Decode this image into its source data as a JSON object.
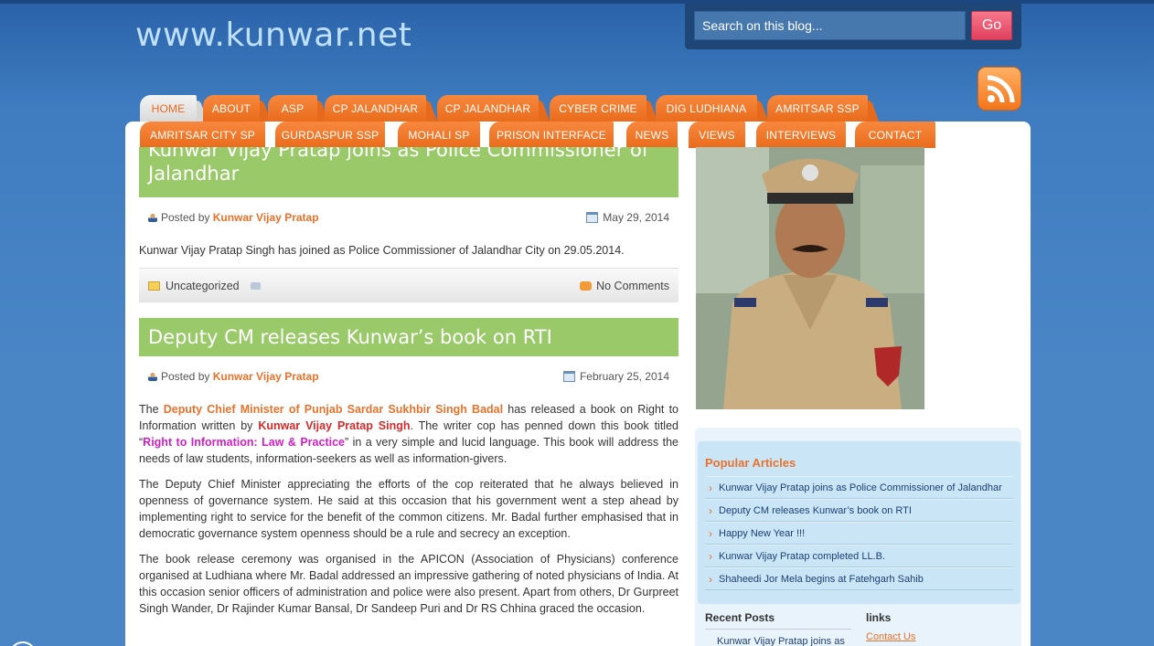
{
  "site": {
    "title": "www.kunwar.net"
  },
  "search": {
    "placeholder": "Search on this blog...",
    "button": "Go"
  },
  "nav": {
    "row1": [
      "HOME",
      "ABOUT",
      "ASP",
      "CP JALANDHAR",
      "CP JALANDHAR",
      "CYBER CRIME",
      "DIG LUDHIANA",
      "AMRITSAR SSP"
    ],
    "row2": [
      "AMRITSAR CITY SP",
      "GURDASPUR SSP",
      "MOHALI SP",
      "PRISON INTERFACE",
      "NEWS",
      "VIEWS",
      "INTERVIEWS",
      "CONTACT"
    ],
    "active": "HOME"
  },
  "post1": {
    "title": "Kunwar Vijay Pratap joins as Police Commissioner of Jalandhar",
    "posted_by_label": "Posted by",
    "author": "Kunwar Vijay Pratap",
    "date": "May 29, 2014",
    "body": "Kunwar Vijay Pratap Singh has joined as Police Commissioner of Jalandhar City on 29.05.2014.",
    "category": "Uncategorized",
    "comments": "No Comments"
  },
  "post2": {
    "title": "Deputy CM releases Kunwar’s book on RTI",
    "posted_by_label": "Posted by",
    "author": "Kunwar Vijay Pratap",
    "date": "February 25, 2014",
    "p1": {
      "t1": "The ",
      "h1": "Deputy Chief Minister of Punjab Sardar Sukhbir Singh Badal",
      "t2": " has released a book on Right to Information written by ",
      "h2": "Kunwar Vijay Pratap Singh",
      "t3": ". The writer cop has penned down this book titled “",
      "h3": "Right to Information: Law & Practice",
      "t4": "” in a very simple and lucid language. This book will address the needs of law students, information-seekers as well as information-givers."
    },
    "p2": "The Deputy Chief Minister appreciating the efforts of the cop reiterated that he always believed in openness of governance system. He said at this occasion that his government went a step ahead by implementing right to service for the benefit of the common citizens. Mr. Badal further emphasised that in democratic governance system openness should be a rule and secrecy an exception.",
    "p3": "The book release ceremony was organised in the APICON (Association of Physicians) conference organised at Ludhiana where Mr. Badal addressed an impressive gathering of noted physicians of India. At this occasion senior officers of administration and police were also present. Apart from others, Dr Gurpreet Singh Wander, Dr Rajinder Kumar Bansal, Dr Sandeep Puri and Dr RS Chhina graced the occasion."
  },
  "popular": {
    "title": "Popular Articles",
    "items": [
      "Kunwar Vijay Pratap joins as Police Commissioner of Jalandhar",
      "Deputy CM releases Kunwar’s book on RTI",
      "Happy New Year !!!",
      "Kunwar Vijay Pratap completed LL.B.",
      "Shaheedi Jor Mela begins at Fatehgarh Sahib"
    ]
  },
  "recent": {
    "title": "Recent Posts",
    "first_item": "Kunwar Vijay Pratap joins as"
  },
  "links": {
    "title": "links",
    "first_item": "Contact Us"
  },
  "colors": {
    "accent": "#ea6c1b",
    "green_bar": "#9ac96a",
    "link_orange": "#e8722c",
    "bg_blue": "#3f7cc0"
  }
}
